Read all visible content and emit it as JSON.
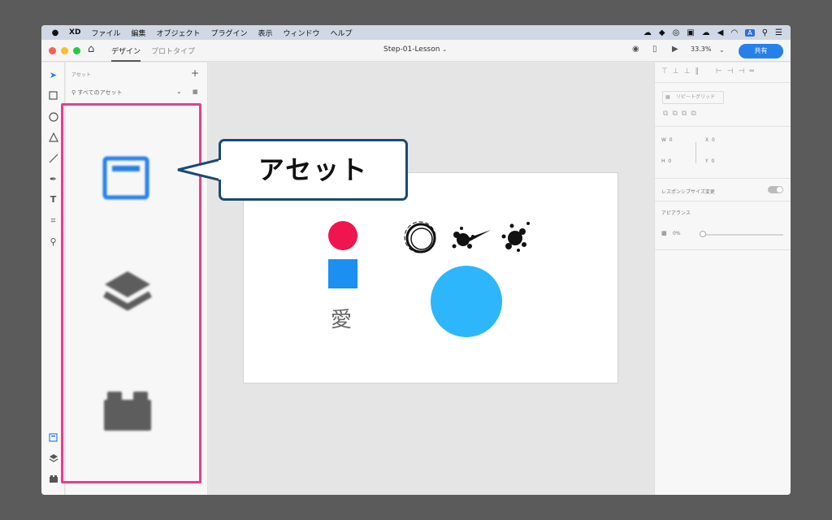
{
  "menubar": {
    "apple_glyph": "",
    "items": [
      "XD",
      "ファイル",
      "編集",
      "オブジェクト",
      "プラグイン",
      "表示",
      "ウィンドウ",
      "ヘルプ"
    ],
    "tray_input_badge": "A"
  },
  "titlebar": {
    "tab_design": "デザイン",
    "tab_prototype": "プロトタイプ",
    "document_title": "Step-01-Lesson",
    "zoom": "33.3%",
    "share_label": "共有"
  },
  "assets_panel": {
    "title": "アセット",
    "search_placeholder": "すべてのアセット"
  },
  "properties": {
    "repeat_grid_label": "リピートグリッド",
    "w_label": "W",
    "w_value": "0",
    "h_label": "H",
    "h_value": "0",
    "x_label": "X",
    "x_value": "0",
    "y_label": "Y",
    "y_value": "0",
    "responsive_label": "レスポンシブサイズ変更",
    "appearance_label": "アピアランス",
    "opacity_value": "0%"
  },
  "artboard": {
    "kanji_text": "愛"
  },
  "callout": {
    "text": "アセット"
  },
  "colors": {
    "accent_blue": "#2680eb",
    "highlight_pink": "#ea3d8d",
    "callout_border": "#1a4b70",
    "shape_red": "#f0144f",
    "shape_square_blue": "#1b8ff2",
    "shape_circle_blue": "#2db6fb"
  }
}
